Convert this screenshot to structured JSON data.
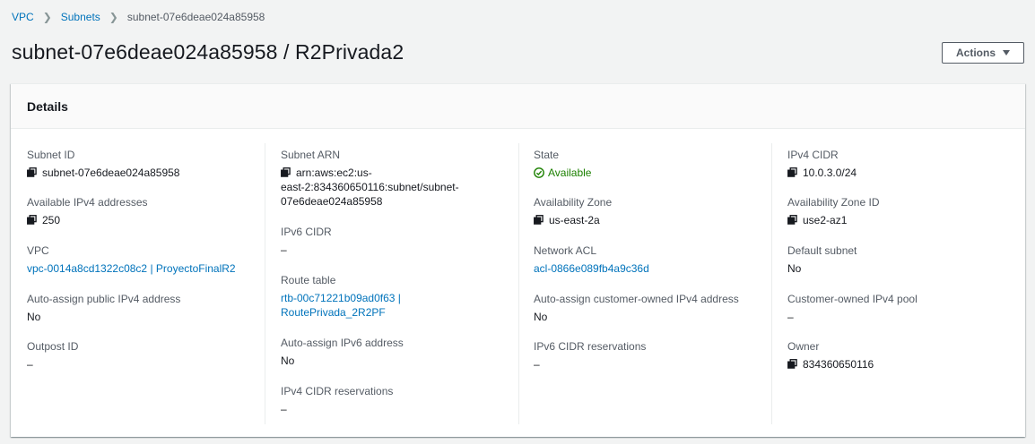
{
  "breadcrumb": {
    "items": [
      "VPC",
      "Subnets"
    ],
    "current": "subnet-07e6deae024a85958"
  },
  "page": {
    "title": "subnet-07e6deae024a85958 / R2Privada2",
    "actions_label": "Actions"
  },
  "details": {
    "heading": "Details",
    "col1": {
      "subnet_id_label": "Subnet ID",
      "subnet_id": "subnet-07e6deae024a85958",
      "avail_ipv4_label": "Available IPv4 addresses",
      "avail_ipv4": "250",
      "vpc_label": "VPC",
      "vpc": "vpc-0014a8cd1322c08c2 | ProyectoFinalR2",
      "auto_public_label": "Auto-assign public IPv4 address",
      "auto_public": "No",
      "outpost_label": "Outpost ID",
      "outpost": "–"
    },
    "col2": {
      "arn_label": "Subnet ARN",
      "arn_line1": "arn:aws:ec2:us-",
      "arn_line2": "east-2:834360650116:subnet/subnet-",
      "arn_line3": "07e6deae024a85958",
      "ipv6_label": "IPv6 CIDR",
      "ipv6": "–",
      "route_label": "Route table",
      "route_line1": "rtb-00c71221b09ad0f63 |",
      "route_line2": "RoutePrivada_2R2PF",
      "auto_ipv6_label": "Auto-assign IPv6 address",
      "auto_ipv6": "No",
      "ipv4_res_label": "IPv4 CIDR reservations",
      "ipv4_res": "–"
    },
    "col3": {
      "state_label": "State",
      "state": "Available",
      "az_label": "Availability Zone",
      "az": "us-east-2a",
      "acl_label": "Network ACL",
      "acl": "acl-0866e089fb4a9c36d",
      "auto_cust_label": "Auto-assign customer-owned IPv4 address",
      "auto_cust": "No",
      "ipv6_res_label": "IPv6 CIDR reservations",
      "ipv6_res": "–"
    },
    "col4": {
      "ipv4_cidr_label": "IPv4 CIDR",
      "ipv4_cidr": "10.0.3.0/24",
      "az_id_label": "Availability Zone ID",
      "az_id": "use2-az1",
      "default_label": "Default subnet",
      "default": "No",
      "cust_pool_label": "Customer-owned IPv4 pool",
      "cust_pool": "–",
      "owner_label": "Owner",
      "owner": "834360650116"
    }
  },
  "colors": {
    "link": "#0073bb",
    "success": "#1d8102",
    "text": "#16191f",
    "muted": "#545b64",
    "background": "#f2f3f3"
  },
  "icons": {
    "copy": "copy-icon",
    "status": "check-circle-icon",
    "breadcrumb_separator": "chevron-right-icon",
    "actions_dropdown": "caret-down-icon"
  }
}
